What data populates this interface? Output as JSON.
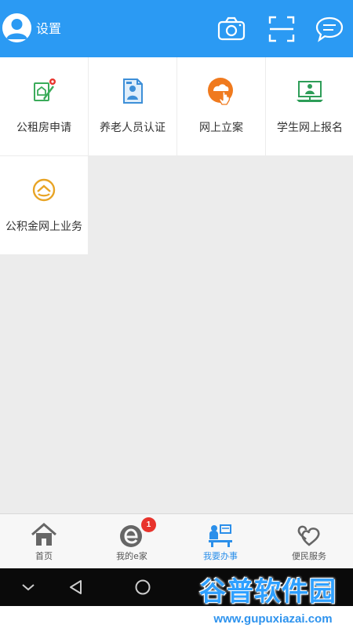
{
  "header": {
    "settings_label": "设置",
    "buttons": [
      "camera-icon",
      "scan-icon",
      "message-icon"
    ],
    "background": "#2b9af3"
  },
  "services": [
    {
      "label": "公租房申请",
      "icon": "housing-application-icon",
      "color": "#3bab5a"
    },
    {
      "label": "养老人员认证",
      "icon": "pension-certification-icon",
      "color": "#3d8fd8"
    },
    {
      "label": "网上立案",
      "icon": "online-filing-icon",
      "color": "#f07a1e"
    },
    {
      "label": "学生网上报名",
      "icon": "student-registration-icon",
      "color": "#2e9d58"
    },
    {
      "label": "公积金网上业务",
      "icon": "provident-fund-icon",
      "color": "#e8a425"
    }
  ],
  "tabs": [
    {
      "label": "首页",
      "icon": "home-icon",
      "active": false
    },
    {
      "label": "我的e家",
      "icon": "my-ehome-icon",
      "active": false,
      "badge": "1"
    },
    {
      "label": "我要办事",
      "icon": "office-icon",
      "active": true
    },
    {
      "label": "便民服务",
      "icon": "service-heart-icon",
      "active": false
    }
  ],
  "accent_color": "#2b8fea",
  "badge_color": "#e8332c",
  "watermark": {
    "title": "谷普软件园",
    "url": "www.gupuxiazai.com"
  }
}
